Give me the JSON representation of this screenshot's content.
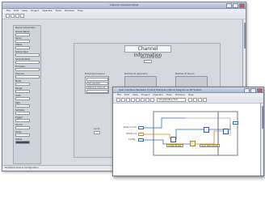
{
  "back_window": {
    "title": "Channel Interface Panel",
    "menu": [
      "File",
      "Edit",
      "View",
      "Project",
      "Operate",
      "Tools",
      "Window",
      "Help"
    ],
    "left_panel": {
      "header": "Device Information",
      "fields": [
        {
          "label": "Device Name",
          "value": ""
        },
        {
          "label": "Serial",
          "value": ""
        },
        {
          "label": "Status",
          "value": ""
        },
        {
          "label": "Device Type",
          "value": ""
        },
        {
          "label": "Serial Number",
          "value": ""
        },
        {
          "label": "Firmware",
          "value": ""
        },
        {
          "label": "Channel",
          "value": ""
        },
        {
          "label": "Mode",
          "value": ""
        },
        {
          "label": "Range",
          "value": ""
        },
        {
          "label": "Units",
          "value": ""
        },
        {
          "label": "Rate",
          "value": ""
        },
        {
          "label": "Samples",
          "value": ""
        },
        {
          "label": "Trigger",
          "value": ""
        },
        {
          "label": "Source",
          "value": ""
        },
        {
          "label": "Delay",
          "value": ""
        },
        {
          "label": "Status",
          "value": ""
        }
      ]
    },
    "channel_panel": {
      "title": "Channel Information",
      "top_label": "Data Channel Count",
      "col1_label": "Embedded Channel",
      "col2_label": "Matched To Application",
      "col3_label": "Matched To Device",
      "col1_rows": [
        "",
        "Not selected",
        "Matched Channel",
        ""
      ],
      "count_label": "Count"
    },
    "status_text": "NI-DAQmx Device Configuration"
  },
  "front_window": {
    "title": "User Interface Hardware Control Example.vi Block Diagram on RT System",
    "menu": [
      "File",
      "Edit",
      "View",
      "Project",
      "Operate",
      "Tools",
      "Window",
      "Help"
    ],
    "toolbar_dropdown": "7pt Application Font",
    "diagram": {
      "inputs": [
        "Data In (ref)",
        "DHCP (on)",
        "Config"
      ],
      "captions": [
        "Create Packet",
        "Send Data Packet"
      ]
    }
  },
  "colors": {
    "accent": "#2b5aa8",
    "wire_orange": "#d08a1f",
    "wire_blue": "#2a6bc2",
    "window_bg": "#d9dde3"
  }
}
